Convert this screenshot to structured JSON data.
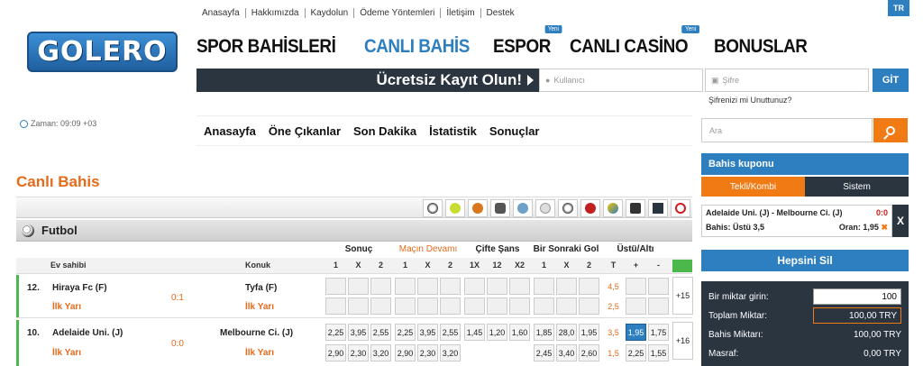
{
  "topnav": [
    "Anasayfa",
    "Hakkımızda",
    "Kaydolun",
    "Ödeme Yöntemleri",
    "İletişim",
    "Destek"
  ],
  "lang": "TR",
  "logo": "GOLERO",
  "mainnav": [
    {
      "label": "SPOR BAHİSLERİ",
      "badge": ""
    },
    {
      "label": "CANLI BAHİS",
      "badge": ""
    },
    {
      "label": "ESPOR",
      "badge": "Yeni"
    },
    {
      "label": "CANLI CASİNO",
      "badge": "Yeni"
    },
    {
      "label": "BONUSLAR",
      "badge": ""
    }
  ],
  "register": {
    "label": "Ücretsiz Kayıt Olun!",
    "user_placeholder": "Kullanıcı",
    "pass_placeholder": "Şifre",
    "go": "GİT",
    "forgot": "Şifrenizi mi Unuttunuz?"
  },
  "time": "Zaman: 09:09 +03",
  "subnav": [
    "Anasayfa",
    "Öne Çıkanlar",
    "Son Dakika",
    "İstatistik",
    "Sonuçlar"
  ],
  "search_placeholder": "Ara",
  "page_title": "Canlı Bahis",
  "sport_title": "Futbol",
  "markets": {
    "sonuc": "Sonuç",
    "mac": "Maçın Devamı",
    "cifte": "Çifte Şans",
    "sonraki": "Bir Sonraki Gol",
    "ustalt": "Üstü/Altı"
  },
  "colheads": {
    "ev": "Ev sahibi",
    "konuk": "Konuk",
    "c1": "1",
    "cx": "X",
    "c2": "2",
    "c1x": "1X",
    "c12": "12",
    "cx2": "X2",
    "ct": "T",
    "cplus": "+",
    "cminus": "-"
  },
  "matches": [
    {
      "no": "12.",
      "home": "Hiraya Fc (F)",
      "score": "0:1",
      "away": "Tyfa (F)",
      "half": "İlk Yarı",
      "half2": "İlk Yarı",
      "t1": "4,5",
      "t2": "2,5",
      "more": "+15"
    },
    {
      "no": "10.",
      "home": "Adelaide Uni. (J)",
      "score": "0:0",
      "away": "Melbourne Ci. (J)",
      "half": "İlk Yarı",
      "half2": "İlk Yarı",
      "r1": [
        "2,25",
        "3,95",
        "2,55",
        "2,25",
        "3,95",
        "2,55",
        "1,45",
        "1,20",
        "1,60",
        "1,85",
        "28,0",
        "1,95",
        "3,5",
        "1,95",
        "1,75"
      ],
      "r2": [
        "2,90",
        "2,30",
        "3,20",
        "2,90",
        "2,30",
        "3,20",
        "",
        "",
        "",
        "2,45",
        "3,40",
        "2,60",
        "1,5",
        "2,25",
        "1,55"
      ],
      "more": "+16"
    }
  ],
  "kupon": {
    "title": "Bahis kuponu",
    "tab1": "Tekli/Kombi",
    "tab2": "Sistem",
    "match": "Adelaide Uni. (J) - Melbourne Ci. (J)",
    "score": "0:0",
    "bet": "Bahis: Üstü 3,5",
    "oran": "Oran: 1,95",
    "x": "X",
    "clear": "Hepsini Sil",
    "amount_label": "Bir miktar girin:",
    "amount": "100",
    "total_label": "Toplam Miktar:",
    "total": "100,00 TRY",
    "bet_amount_label": "Bahis Miktarı:",
    "bet_amount": "100,00 TRY",
    "fee_label": "Masraf:",
    "fee": "0,00 TRY"
  },
  "colors": {
    "blue": "#2e7fc0",
    "orange": "#f07a14",
    "dark": "#2a3540"
  }
}
